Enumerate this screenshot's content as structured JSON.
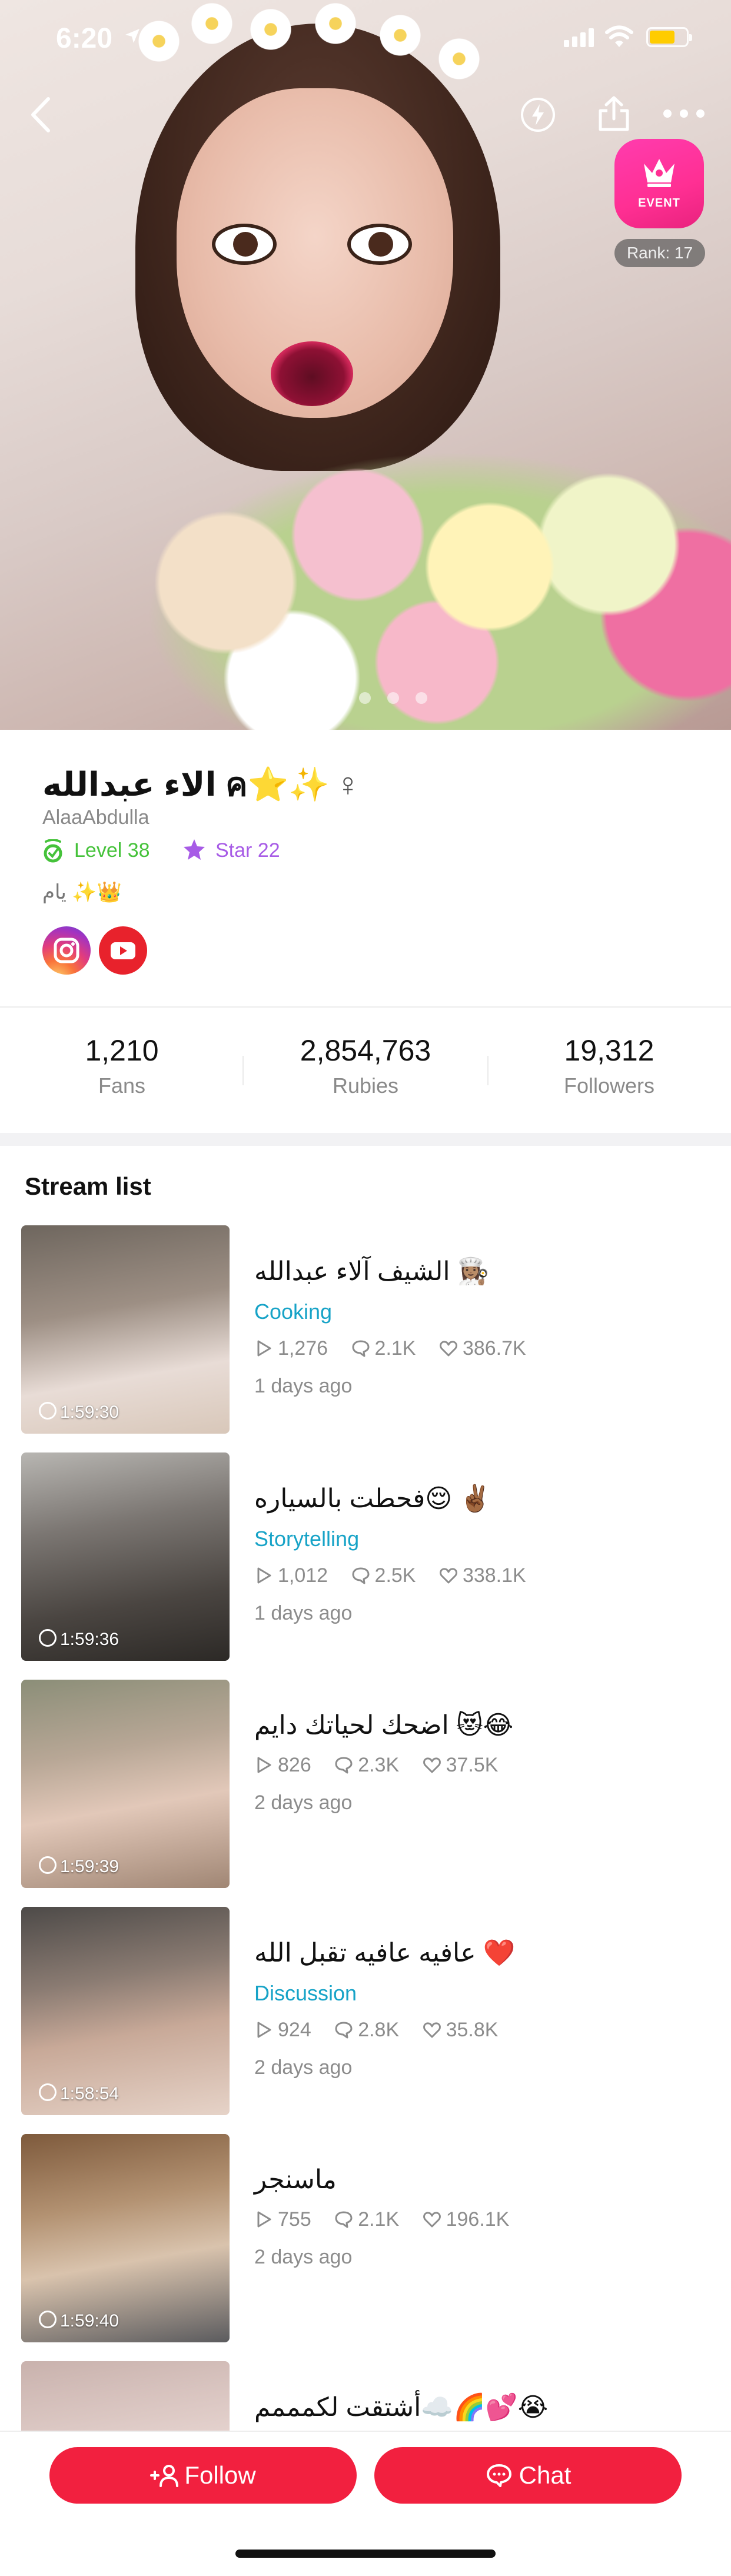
{
  "status_bar": {
    "time": "6:20"
  },
  "hero": {
    "event_label": "EVENT",
    "rank": "Rank: 17",
    "page_dots": 5,
    "active_dot": 0
  },
  "profile": {
    "name": "الاء عبدالله ค⭐✨",
    "gender_symbol": "♀",
    "handle": "AlaaAbdulla",
    "level": "Level 38",
    "star": "Star 22",
    "bio": "يام ✨👑",
    "socials": [
      "instagram",
      "youtube"
    ]
  },
  "stats": {
    "fans": {
      "value": "1,210",
      "label": "Fans"
    },
    "rubies": {
      "value": "2,854,763",
      "label": "Rubies"
    },
    "followers": {
      "value": "19,312",
      "label": "Followers"
    }
  },
  "stream_list": {
    "title": "Stream list",
    "items": [
      {
        "title": "الشيف آلاء عبدالله 👩🏽‍🍳",
        "category": "Cooking",
        "plays": "1,276",
        "comments": "2.1K",
        "likes": "386.7K",
        "ago": "1 days ago",
        "duration": "1:59:30"
      },
      {
        "title": "فحطت بالسياره😌 ✌🏾",
        "category": "Storytelling",
        "plays": "1,012",
        "comments": "2.5K",
        "likes": "338.1K",
        "ago": "1 days ago",
        "duration": "1:59:36"
      },
      {
        "title": "اضحك لحياتك دايم 😻😂",
        "category": "",
        "plays": "826",
        "comments": "2.3K",
        "likes": "37.5K",
        "ago": "2 days ago",
        "duration": "1:59:39"
      },
      {
        "title": "عافيه عافيه تقبل الله ❤️",
        "category": "Discussion",
        "plays": "924",
        "comments": "2.8K",
        "likes": "35.8K",
        "ago": "2 days ago",
        "duration": "1:58:54"
      },
      {
        "title": "ماسنجر",
        "category": "",
        "plays": "755",
        "comments": "2.1K",
        "likes": "196.1K",
        "ago": "2 days ago",
        "duration": "1:59:40"
      },
      {
        "title": "أشتقت لكمممم☁️🌈💕😭",
        "category": "",
        "plays": "",
        "comments": "",
        "likes": "",
        "ago": "",
        "duration": ""
      }
    ]
  },
  "actions": {
    "follow_label": "Follow",
    "chat_label": "Chat"
  },
  "colors": {
    "accent": "#f2203f",
    "category": "#17a3c7",
    "level": "#45c23a",
    "star": "#a75be6",
    "event": "#ff2f93"
  }
}
